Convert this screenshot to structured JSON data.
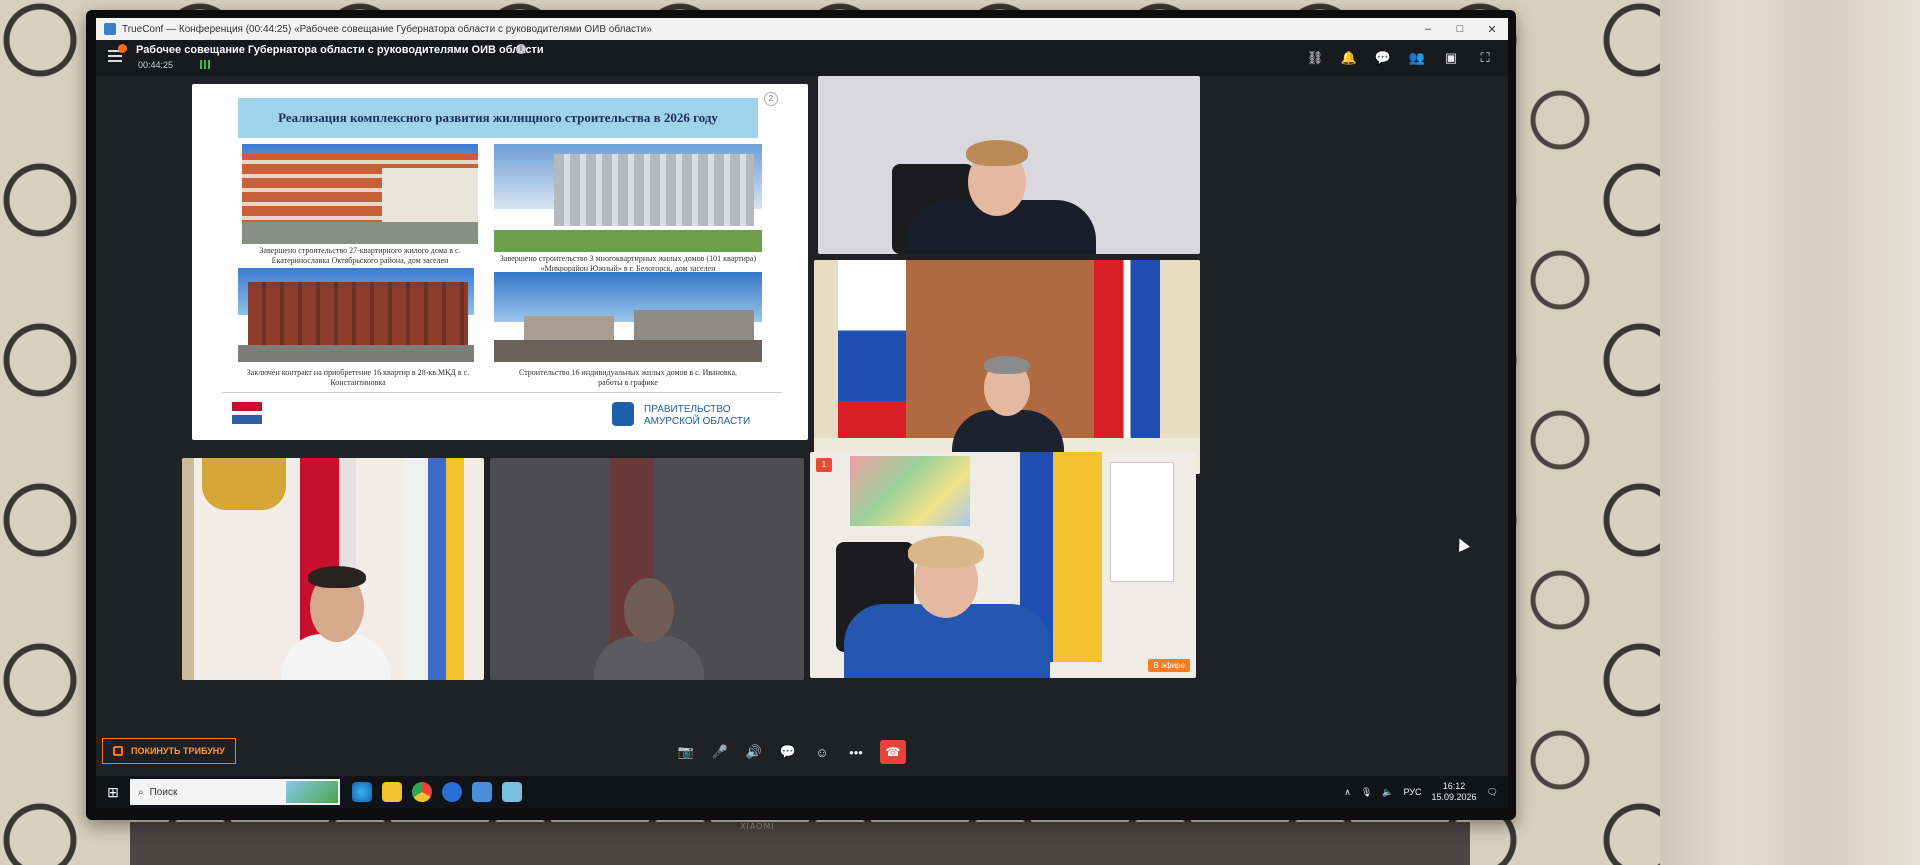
{
  "window": {
    "title": "TrueConf — Конференция (00:44:25) «Рабочее совещание Губернатора области с руководителями ОИВ области»",
    "controls": {
      "minimize": "–",
      "maximize": "□",
      "close": "✕"
    }
  },
  "conference": {
    "title": "Рабочее совещание Губернатора области с руководителями ОИВ области",
    "timer": "00:44:25",
    "header_icons": [
      "link-icon",
      "bell-icon",
      "chat-icon",
      "participants-icon",
      "screen-share-icon",
      "fullscreen-icon"
    ]
  },
  "slide": {
    "number": "2",
    "heading": "Реализация комплексного развития жилищного строительства в 2026 году",
    "captions": [
      "Завершено строительство 27-квартирного жилого дома в с. Екатеринославка Октябрьского района, дом заселен",
      "Завершено строительство 3 многоквартирных жилых домов (101 квартира) «Микрорайон Южный» в г. Белогорск, дом заселен",
      "Заключен контракт на приобретение 16 квартир в 28-кв.МКД в с. Константиновка",
      "Строительство 16 индивидуальных жилых домов в с. Ивановка, работы в графике"
    ],
    "org_line1": "ПРАВИТЕЛЬСТВО",
    "org_line2": "АМУРСКОЙ ОБЛАСТИ"
  },
  "tiles": {
    "speaker_badge": "1",
    "on_air_label": "В эфире"
  },
  "controls": {
    "leave_label": "ПОКИНУТЬ ТРИБУНУ"
  },
  "taskbar": {
    "search_placeholder": "Поиск",
    "lang": "РУС",
    "time": "16:12",
    "date": "15.09.2026"
  },
  "colors": {
    "accent_orange": "#ff7a1a",
    "hangup_red": "#e8423a",
    "banner_blue": "#9fd3ea"
  }
}
